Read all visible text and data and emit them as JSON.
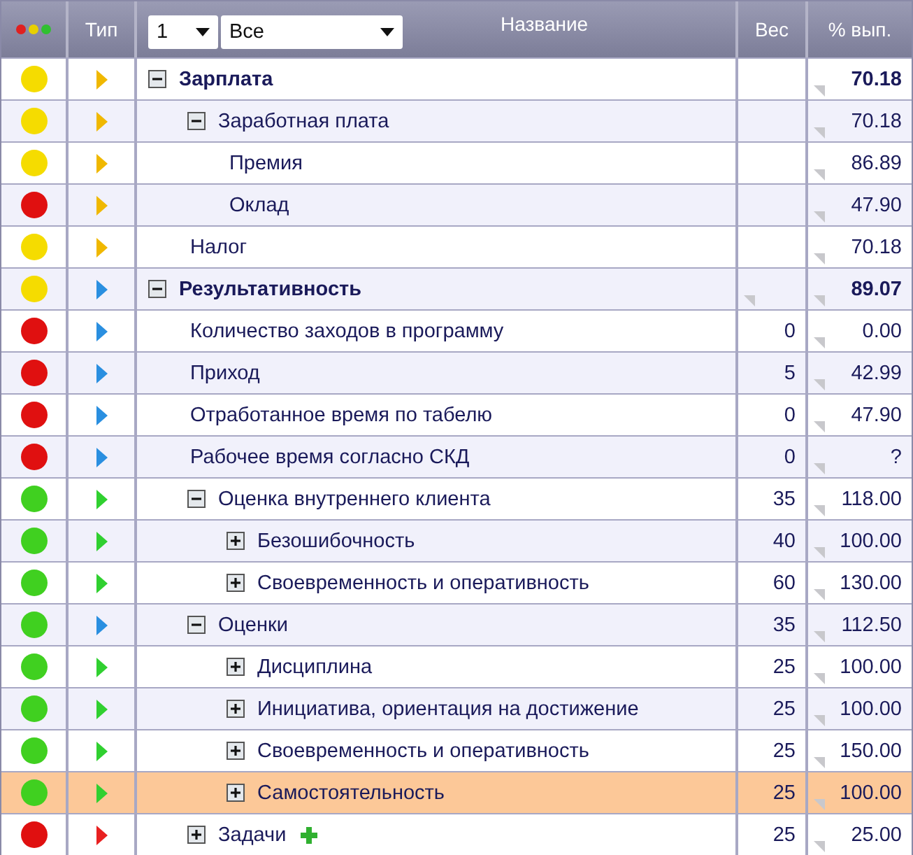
{
  "header": {
    "type_label": "Тип",
    "level_select": "1",
    "filter_select": "Все",
    "name_label": "Название",
    "weight_label": "Вес",
    "percent_label": "% вып."
  },
  "rows": [
    {
      "name": "Зарплата",
      "color": "#f5dc00",
      "kind": "yellow",
      "expanded": true,
      "percent": "70.18",
      "selected": false,
      "children": [
        {
          "name": "Заработная плата",
          "color": "#f5dc00",
          "kind": "yellow",
          "expanded": true,
          "percent": "70.18",
          "selected": false,
          "children": [
            {
              "name": "Премия",
              "color": "#f5dc00",
              "kind": "yellow",
              "percent": "86.89",
              "selected": false
            },
            {
              "name": "Оклад",
              "color": "#e01010",
              "kind": "yellow",
              "percent": "47.90",
              "selected": false
            }
          ]
        },
        {
          "name": "Налог",
          "color": "#f5dc00",
          "kind": "yellow",
          "percent": "70.18",
          "selected": false
        }
      ]
    },
    {
      "name": "Результативность",
      "color": "#f5dc00",
      "kind": "blue",
      "expanded": true,
      "weight_marker": true,
      "percent": "89.07",
      "selected": false,
      "children": [
        {
          "name": "Количество заходов в программу",
          "color": "#e01010",
          "kind": "blue",
          "weight": "0",
          "percent": "0.00",
          "selected": false
        },
        {
          "name": "Приход",
          "color": "#e01010",
          "kind": "blue",
          "weight": "5",
          "percent": "42.99",
          "selected": false
        },
        {
          "name": "Отработанное время по табелю",
          "color": "#e01010",
          "kind": "blue",
          "weight": "0",
          "percent": "47.90",
          "selected": false
        },
        {
          "name": "Рабочее время согласно СКД",
          "color": "#e01010",
          "kind": "blue",
          "weight": "0",
          "percent": "?",
          "selected": false
        },
        {
          "name": "Оценка внутреннего клиента",
          "color": "#40d020",
          "kind": "green",
          "expanded": true,
          "weight": "35",
          "percent": "118.00",
          "selected": false,
          "children": [
            {
              "name": "Безошибочность",
              "color": "#40d020",
              "kind": "green",
              "expanded": false,
              "weight": "40",
              "percent": "100.00",
              "selected": false
            },
            {
              "name": "Своевременность и оперативность",
              "color": "#40d020",
              "kind": "green",
              "expanded": false,
              "weight": "60",
              "percent": "130.00",
              "selected": false
            }
          ]
        },
        {
          "name": "Оценки",
          "color": "#40d020",
          "kind": "blue",
          "expanded": true,
          "weight": "35",
          "percent": "112.50",
          "selected": false,
          "children": [
            {
              "name": "Дисциплина",
              "color": "#40d020",
              "kind": "green",
              "expanded": false,
              "weight": "25",
              "percent": "100.00",
              "selected": false
            },
            {
              "name": "Инициатива, ориентация на достижение",
              "color": "#40d020",
              "kind": "green",
              "expanded": false,
              "weight": "25",
              "percent": "100.00",
              "selected": false
            },
            {
              "name": "Своевременность и оперативность",
              "color": "#40d020",
              "kind": "green",
              "expanded": false,
              "weight": "25",
              "percent": "150.00",
              "selected": false
            },
            {
              "name": "Самостоятельность",
              "color": "#40d020",
              "kind": "green",
              "expanded": false,
              "weight": "25",
              "percent": "100.00",
              "selected": true
            }
          ]
        },
        {
          "name": "Задачи",
          "color": "#e01010",
          "kind": "red",
          "expanded": false,
          "add_button": true,
          "weight": "25",
          "percent": "25.00",
          "selected": false
        }
      ]
    }
  ]
}
